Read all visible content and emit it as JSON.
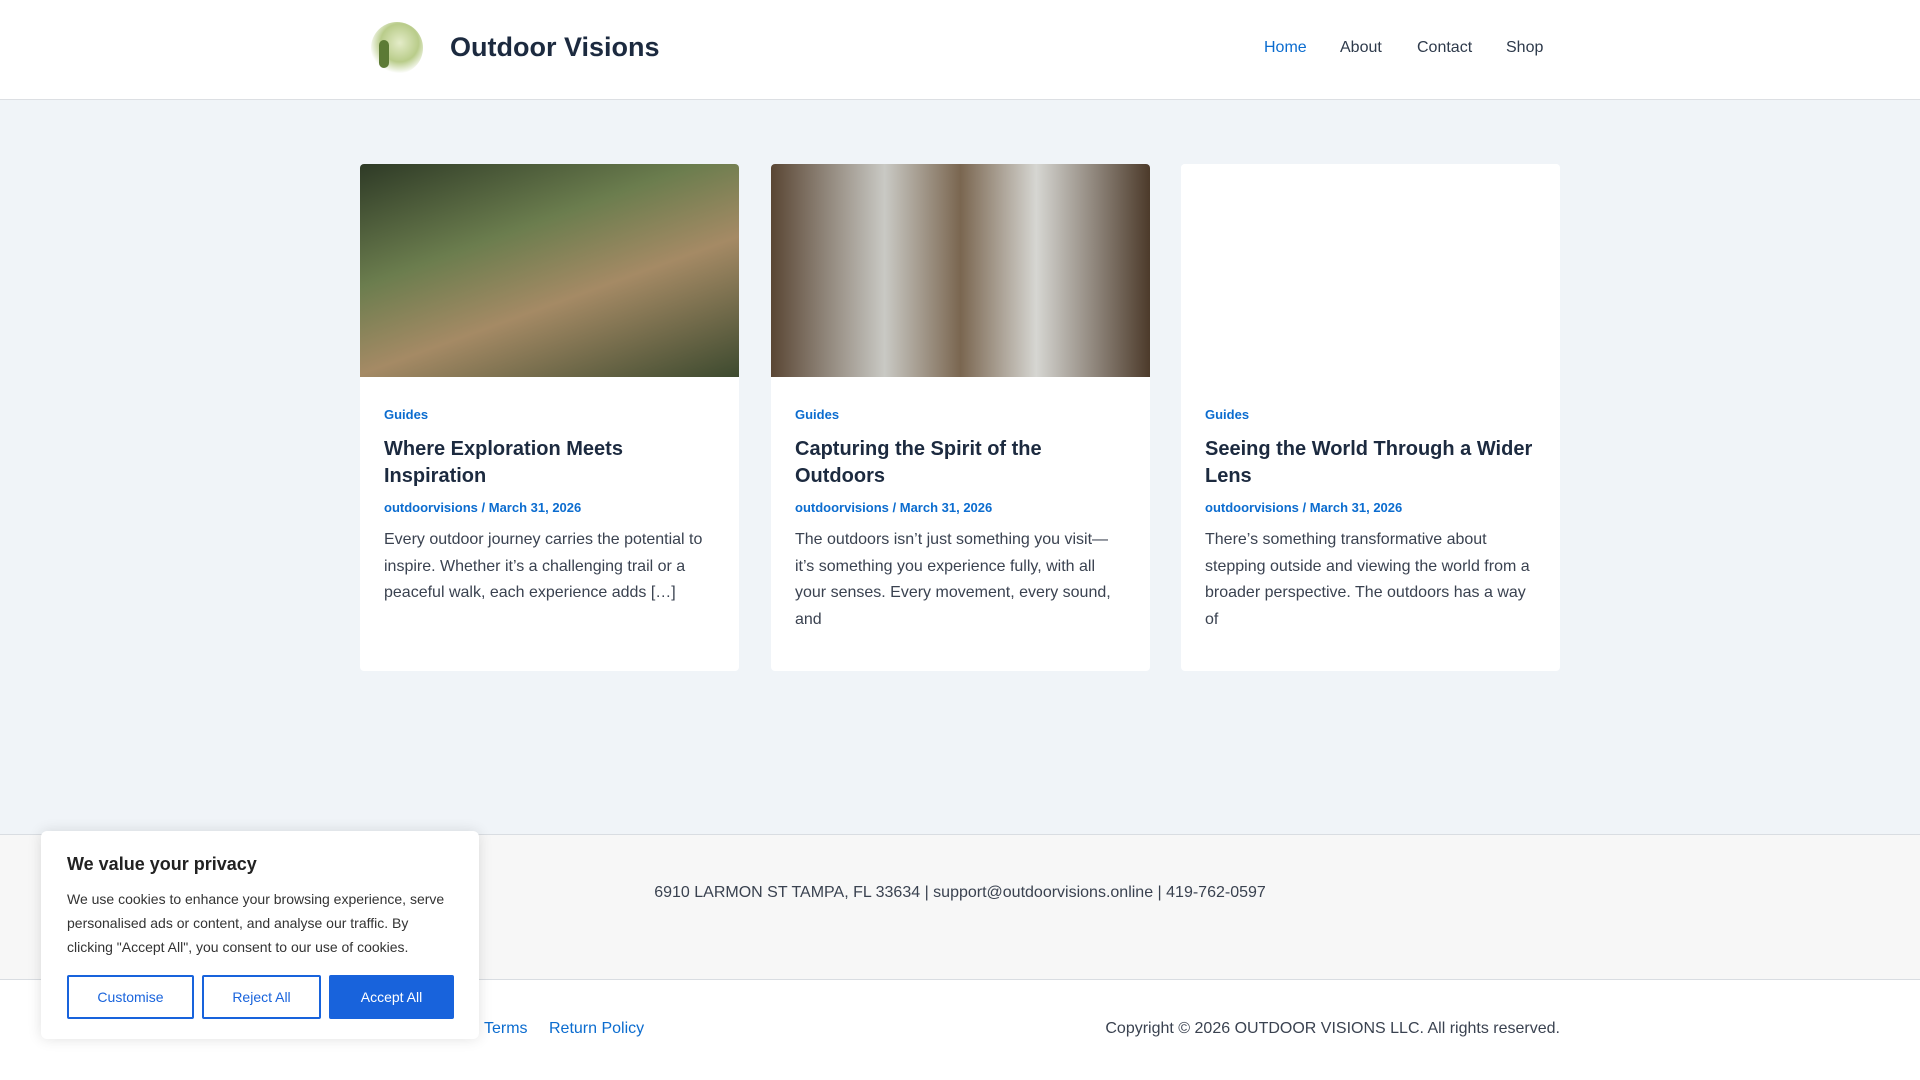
{
  "header": {
    "site_title": "Outdoor Visions",
    "nav": [
      "Home",
      "About",
      "Contact",
      "Shop"
    ],
    "active": "Home"
  },
  "posts": [
    {
      "category": "Guides",
      "title": "Where Exploration Meets Inspiration",
      "author": "outdoorvisions",
      "date": "March 31, 2026",
      "excerpt": "Every outdoor journey carries the potential to inspire. Whether it’s a challenging trail or a peaceful walk, each experience adds […]"
    },
    {
      "category": "Guides",
      "title": "Capturing the Spirit of the Outdoors",
      "author": "outdoorvisions",
      "date": "March 31, 2026",
      "excerpt": "The outdoors isn’t just something you visit—it’s something you experience fully, with all your senses. Every movement, every sound, and"
    },
    {
      "category": "Guides",
      "title": "Seeing the World Through a Wider Lens",
      "author": "outdoorvisions",
      "date": "March 31, 2026",
      "excerpt": "There’s something transformative about stepping outside and viewing the world from a broader perspective. The outdoors has a way of"
    }
  ],
  "footer": {
    "address": "6910 LARMON ST TAMPA, FL 33634 | support@outdoorvisions.online | 419-762-0597",
    "links": [
      "Terms",
      "Return Policy"
    ],
    "copyright": "Copyright © 2026 OUTDOOR VISIONS LLC. All rights reserved."
  },
  "cookie": {
    "title": "We value your privacy",
    "text": "We use cookies to enhance your browsing experience, serve personalised ads or content, and analyse our traffic. By clicking \"Accept All\", you consent to our use of cookies.",
    "customise": "Customise",
    "reject": "Reject All",
    "accept": "Accept All"
  },
  "colors": {
    "accent": "#0b6ccf",
    "button": "#1863dc"
  }
}
